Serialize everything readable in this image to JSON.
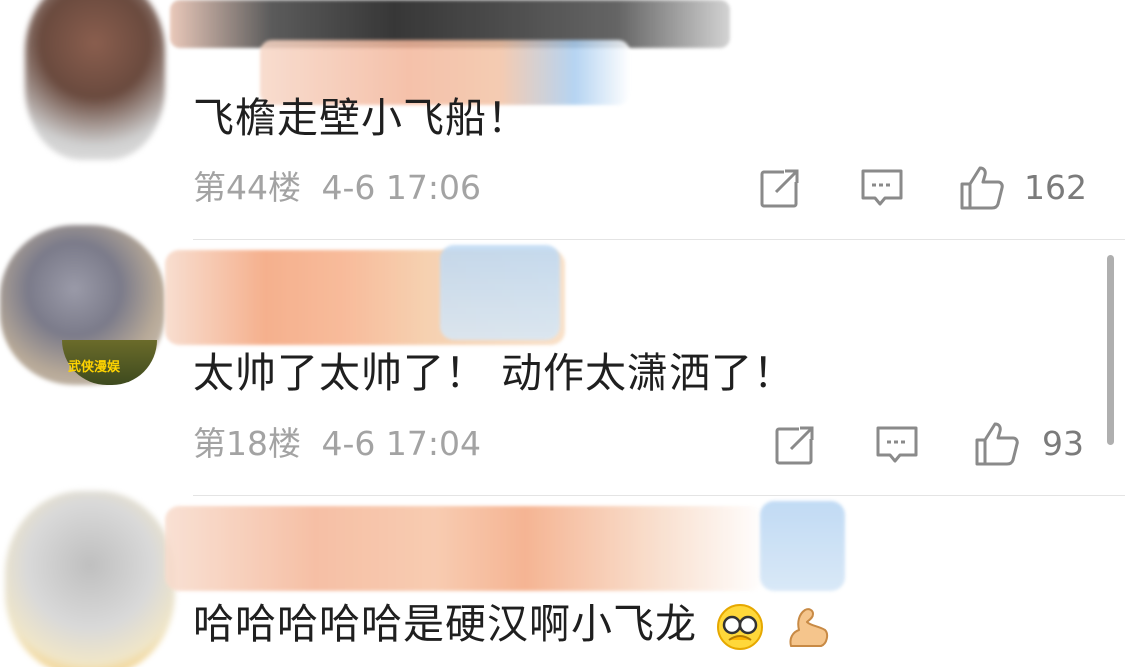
{
  "comments": [
    {
      "text": "飞檐走壁小飞船！",
      "floor": "第44楼",
      "date": "4-6 17:06",
      "likes": "162",
      "emojis": []
    },
    {
      "text": "太帅了太帅了！ 动作太潇洒了！",
      "floor": "第18楼",
      "date": "4-6 17:04",
      "likes": "93",
      "avatar_badge": "武侠漫娱",
      "emojis": []
    },
    {
      "text": "哈哈哈哈哈是硬汉啊小飞龙",
      "emojis": [
        "face-with-glasses-emoji",
        "flexed-biceps-emoji"
      ]
    }
  ],
  "icons": [
    "share-icon",
    "comment-icon",
    "like-icon"
  ],
  "colors": {
    "text": "#1f1f1f",
    "meta": "#a3a3a3",
    "count": "#7b7b7b",
    "divider": "#e4e4e4"
  }
}
